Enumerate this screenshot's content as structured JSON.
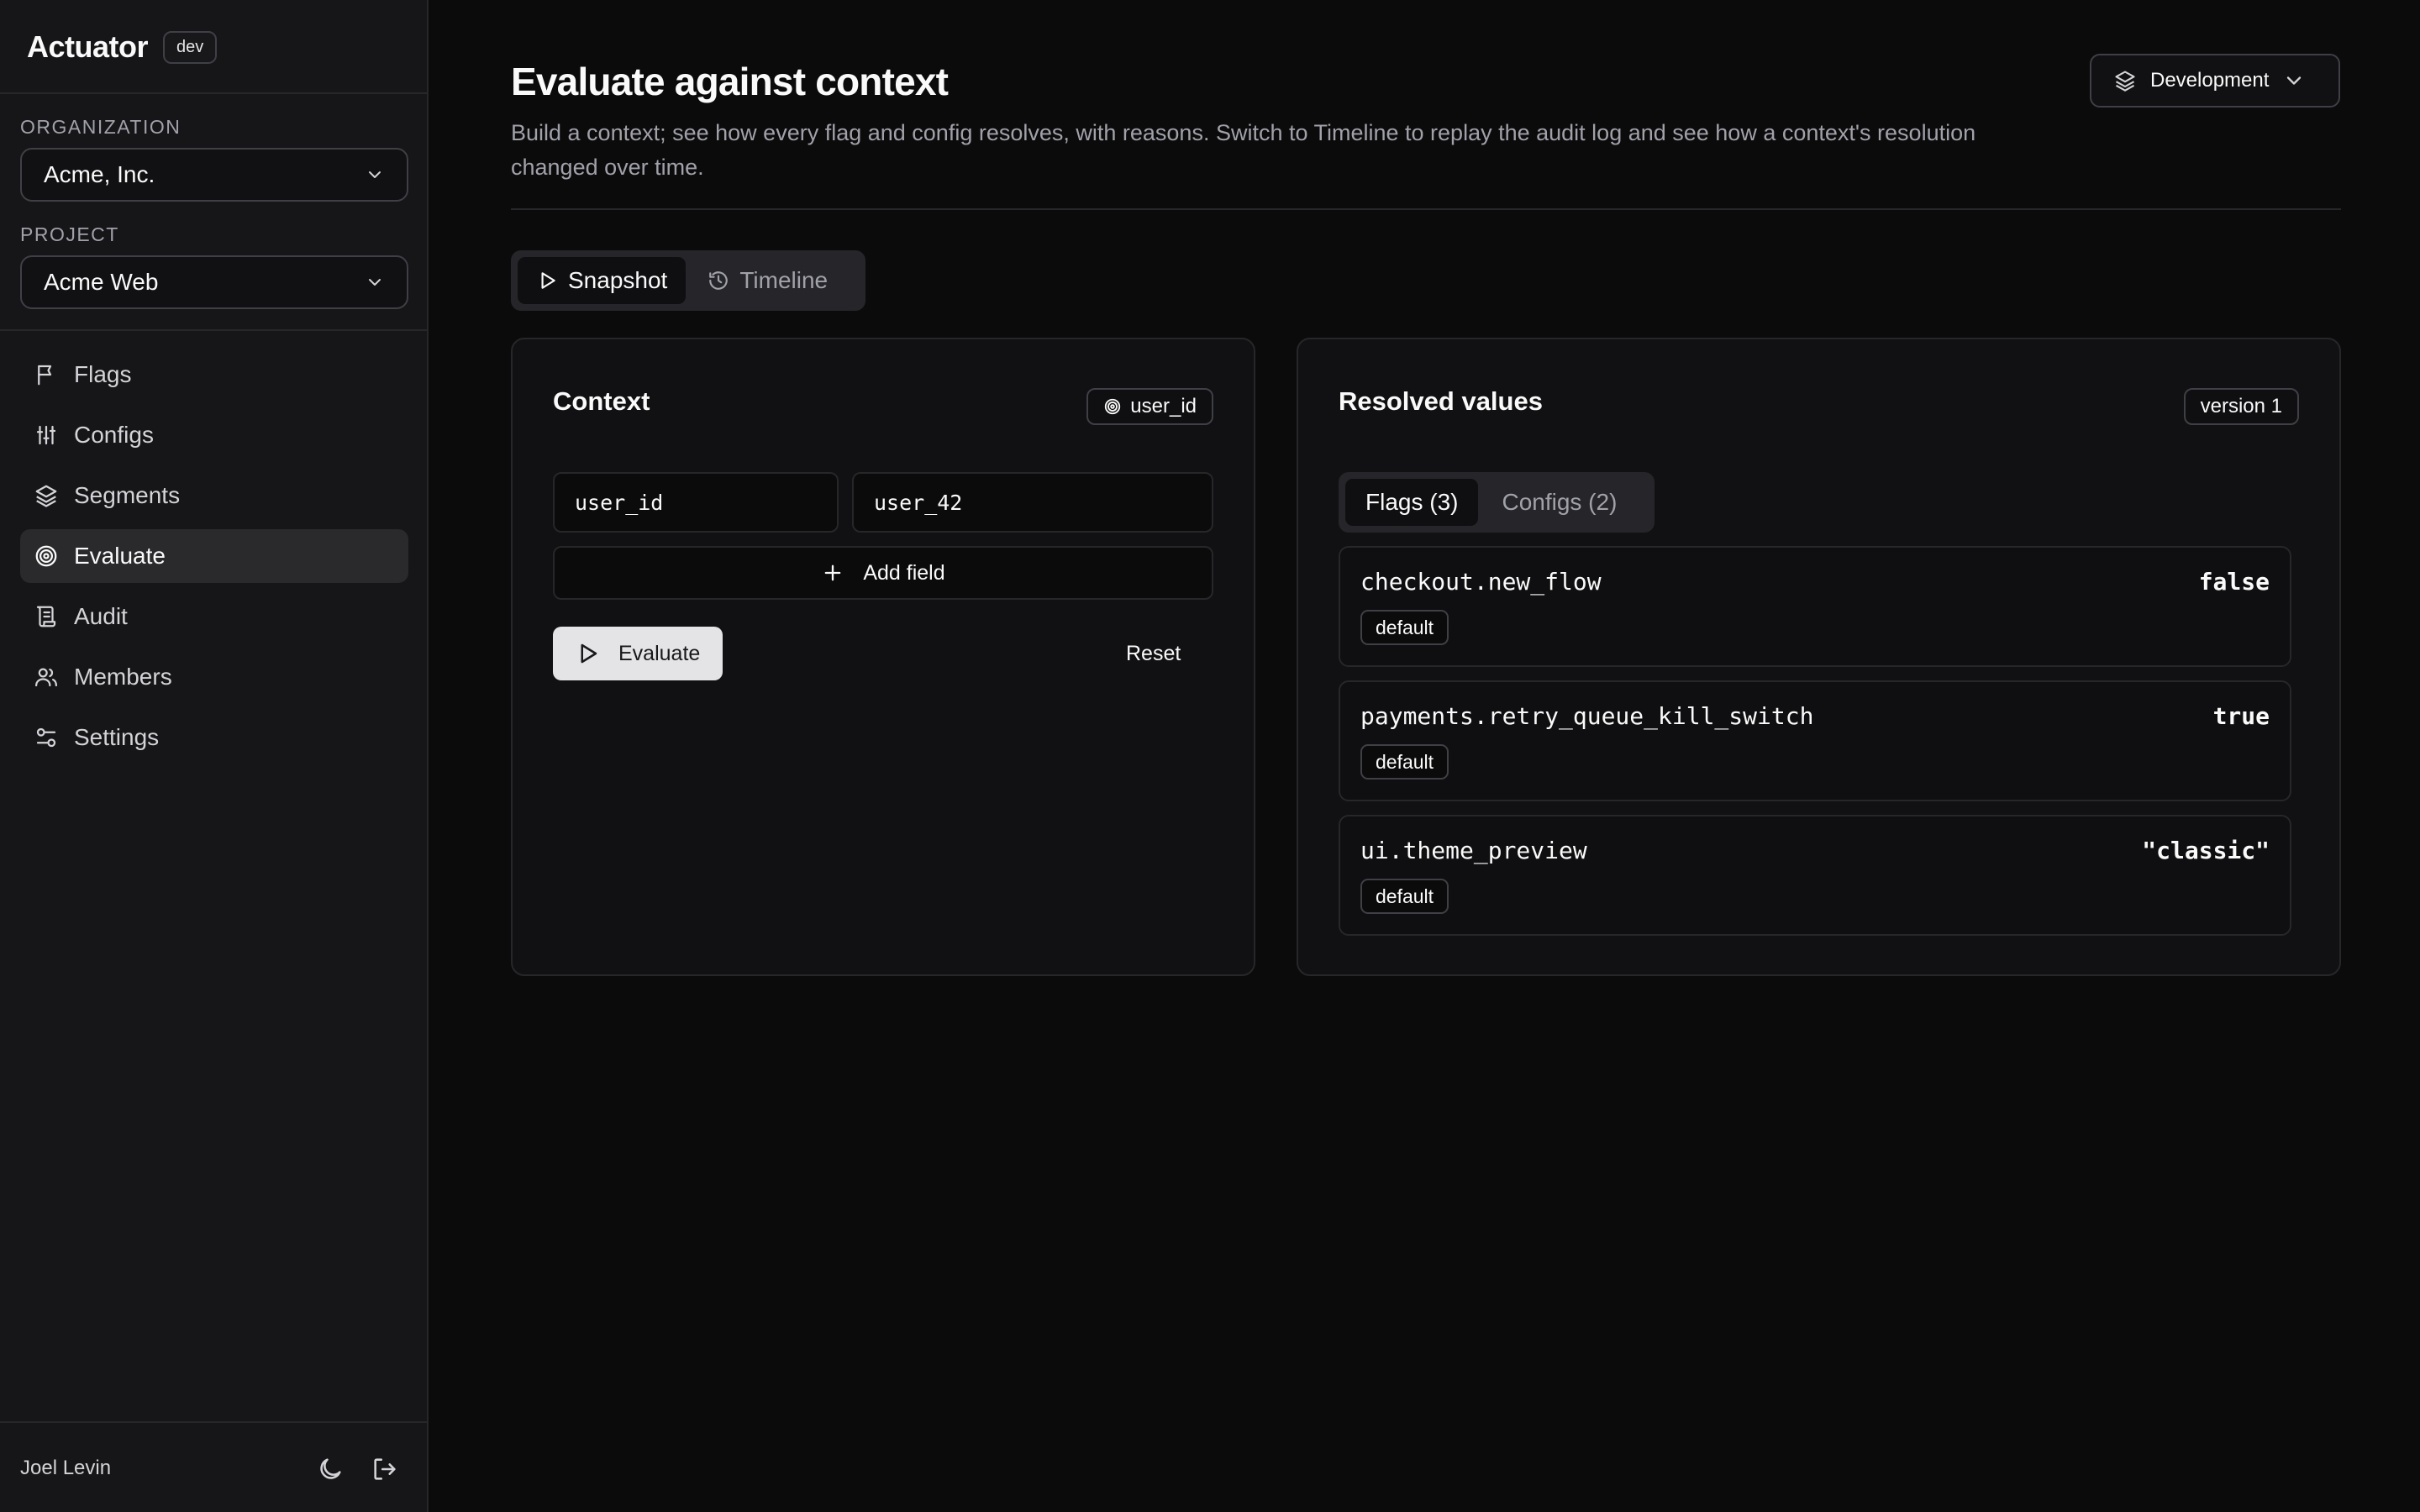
{
  "app": {
    "name": "Actuator",
    "env_badge": "dev"
  },
  "sidebar": {
    "organization_label": "ORGANIZATION",
    "organization_value": "Acme, Inc.",
    "project_label": "PROJECT",
    "project_value": "Acme Web",
    "items": [
      {
        "label": "Flags",
        "icon": "flag-icon",
        "active": false
      },
      {
        "label": "Configs",
        "icon": "sliders-icon",
        "active": false
      },
      {
        "label": "Segments",
        "icon": "layers-icon",
        "active": false
      },
      {
        "label": "Evaluate",
        "icon": "target-icon",
        "active": true
      },
      {
        "label": "Audit",
        "icon": "scroll-icon",
        "active": false
      },
      {
        "label": "Members",
        "icon": "users-icon",
        "active": false
      },
      {
        "label": "Settings",
        "icon": "settings-icon",
        "active": false
      }
    ],
    "user_name": "Joel Levin"
  },
  "header": {
    "title": "Evaluate against context",
    "description": "Build a context; see how every flag and config resolves, with reasons. Switch to Timeline to replay the audit log and see how a context's resolution changed over time.",
    "environment": "Development"
  },
  "mode_tabs": [
    {
      "label": "Snapshot",
      "active": true
    },
    {
      "label": "Timeline",
      "active": false
    }
  ],
  "context": {
    "title": "Context",
    "key_badge": "user_id",
    "fields": [
      {
        "key": "user_id",
        "value": "user_42"
      }
    ],
    "add_field_label": "Add field",
    "evaluate_label": "Evaluate",
    "reset_label": "Reset"
  },
  "resolved": {
    "title": "Resolved values",
    "version": "version 1",
    "tabs": [
      {
        "label": "Flags (3)",
        "active": true
      },
      {
        "label": "Configs (2)",
        "active": false
      }
    ],
    "flags": [
      {
        "key": "checkout.new_flow",
        "value": "false",
        "reason": "default"
      },
      {
        "key": "payments.retry_queue_kill_switch",
        "value": "true",
        "reason": "default"
      },
      {
        "key": "ui.theme_preview",
        "value": "\"classic\"",
        "reason": "default"
      }
    ]
  },
  "colors": {
    "background": "#0b0b0c",
    "sidebar": "#161618",
    "border": "#27272a",
    "text": "#fafafa",
    "muted": "#a1a1aa"
  }
}
